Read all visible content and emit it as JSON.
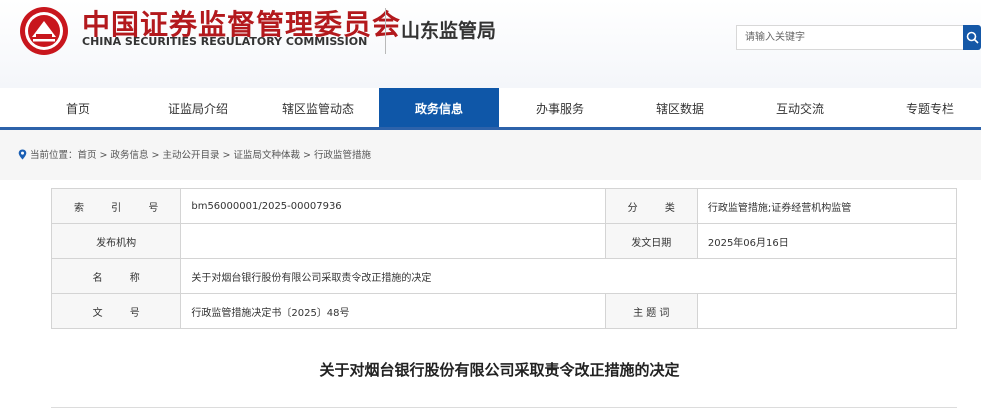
{
  "header": {
    "title_cn": "中国证券监督管理委员会",
    "title_en": "CHINA SECURITIES REGULATORY COMMISSION",
    "bureau": "山东监管局",
    "logo_icon": "csrc-emblem-icon",
    "brand_color": "#b3191d"
  },
  "search": {
    "placeholder": "请输入关键字",
    "button_icon": "search-icon",
    "button_color": "#1558a7"
  },
  "nav": {
    "active_color": "#0f57a8",
    "items": [
      {
        "label": "首页"
      },
      {
        "label": "证监局介绍"
      },
      {
        "label": "辖区监管动态"
      },
      {
        "label": "政务信息",
        "active": true
      },
      {
        "label": "办事服务"
      },
      {
        "label": "辖区数据"
      },
      {
        "label": "互动交流"
      },
      {
        "label": "专题专栏"
      }
    ]
  },
  "breadcrumb": {
    "icon": "location-pin-icon",
    "prefix": "当前位置：",
    "items": [
      "首页",
      "政务信息",
      "主动公开目录",
      "证监局文种体裁",
      "行政监管措施"
    ],
    "separator": ">"
  },
  "meta": {
    "index_label": "索 引 号",
    "index_value": "bm56000001/2025-00007936",
    "category_label": "分 类",
    "category_value": "行政监管措施;证券经营机构监管",
    "issuer_label": "发布机构",
    "issuer_value": "",
    "date_label": "发文日期",
    "date_value": "2025年06月16日",
    "name_label": "名 称",
    "name_value": "关于对烟台银行股份有限公司采取责令改正措施的决定",
    "docno_label": "文 号",
    "docno_value": "行政监管措施决定书〔2025〕48号",
    "keywords_label": "主 题 词",
    "keywords_value": ""
  },
  "document": {
    "title": "关于对烟台银行股份有限公司采取责令改正措施的决定"
  }
}
